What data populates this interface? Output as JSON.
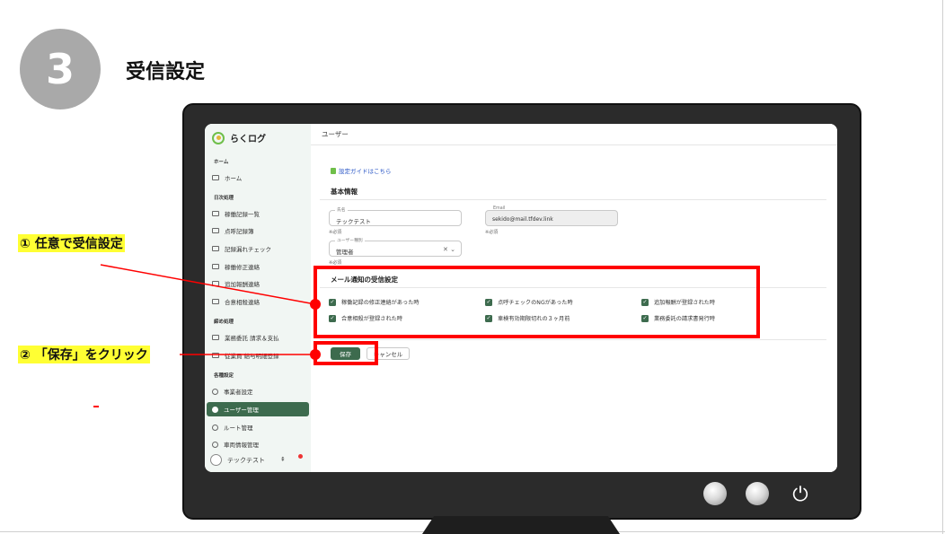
{
  "step": {
    "number": "3",
    "title": "受信設定"
  },
  "app": {
    "brand": "らくログ",
    "page_title": "ユーザー",
    "sidebar": {
      "sections": {
        "home": "ホーム",
        "daily": "日次処理",
        "monthly": "締め処理",
        "settings": "各種設定"
      },
      "items": [
        {
          "label": "ホーム"
        },
        {
          "label": "稼働記録一覧"
        },
        {
          "label": "点呼記録簿"
        },
        {
          "label": "記録漏れチェック"
        },
        {
          "label": "稼働修正連絡"
        },
        {
          "label": "追加報酬連絡"
        },
        {
          "label": "合意相殺連絡"
        },
        {
          "label": "業務委託 請求＆支払"
        },
        {
          "label": "従業員 給与明細登録"
        },
        {
          "label": "事業者設定"
        },
        {
          "label": "ユーザー管理"
        },
        {
          "label": "ルート管理"
        },
        {
          "label": "車両情報管理"
        }
      ],
      "user_name": "テックテスト"
    },
    "guide_link": "設定ガイドはこちら",
    "basic_info_title": "基本情報",
    "fields": {
      "name": {
        "label": "氏名",
        "value": "テックテスト",
        "required": "※必須"
      },
      "email": {
        "label": "Email",
        "value": "sekido@mail.tfdev.link",
        "required": "※必須"
      },
      "user_type": {
        "label": "ユーザー種別",
        "value": "管理者",
        "required": "※必須"
      }
    },
    "notification_title": "メール通知の受信設定",
    "checkboxes": [
      {
        "label": "稼働記録の修正連絡があった時",
        "checked": true
      },
      {
        "label": "点呼チェックのNGがあった時",
        "checked": true
      },
      {
        "label": "追加報酬が登録された時",
        "checked": true
      },
      {
        "label": "合意相殺が登録された時",
        "checked": true
      },
      {
        "label": "車検有効期限切れの３ヶ月前",
        "checked": true
      },
      {
        "label": "業務委託の請求書発行時",
        "checked": true
      }
    ],
    "save_label": "保存",
    "cancel_label": "キャンセル"
  },
  "annotations": {
    "callout_1": "① 任意で受信設定",
    "callout_2": "② 「保存」をクリック",
    "highlight_color": "#ff0000",
    "callout_bg": "#ffff33"
  },
  "colors": {
    "accent": "#3d6b4e",
    "sidebar_bg": "#f1f6f3",
    "link": "#2a56c6"
  }
}
